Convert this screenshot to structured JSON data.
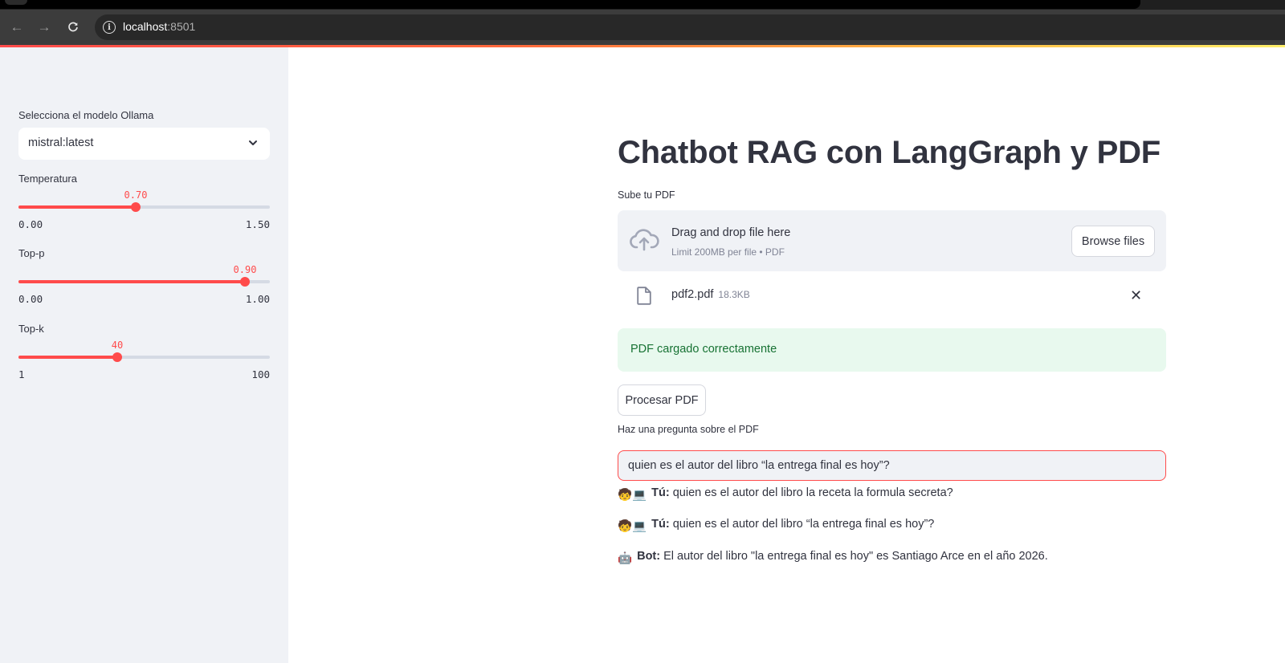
{
  "browser": {
    "url_host": "localhost",
    "url_port": ":8501"
  },
  "sidebar": {
    "model_label": "Selecciona el modelo Ollama",
    "model_value": "mistral:latest",
    "temperature": {
      "label": "Temperatura",
      "value": "0.70",
      "min": "0.00",
      "max": "1.50",
      "fraction": 0.4667
    },
    "top_p": {
      "label": "Top-p",
      "value": "0.90",
      "min": "0.00",
      "max": "1.00",
      "fraction": 0.9
    },
    "top_k": {
      "label": "Top-k",
      "value": "40",
      "min": "1",
      "max": "100",
      "fraction": 0.394
    }
  },
  "main": {
    "title": "Chatbot RAG con LangGraph y PDF",
    "upload_label": "Sube tu PDF",
    "dropzone_title": "Drag and drop file here",
    "dropzone_limit": "Limit 200MB per file • PDF",
    "browse_label": "Browse files",
    "file_name": "pdf2.pdf",
    "file_size": "18.3KB",
    "success_message": "PDF cargado correctamente",
    "process_label": "Procesar PDF",
    "question_label": "Haz una pregunta sobre el PDF",
    "question_value": "quien es el autor del libro “la entrega final es hoy”?"
  },
  "chat": [
    {
      "emoji": "🧒💻",
      "speaker": "Tú:",
      "text": " quien es el autor del libro la receta la formula secreta?"
    },
    {
      "emoji": "🧒💻",
      "speaker": "Tú:",
      "text": " quien es el autor del libro “la entrega final es hoy”?"
    },
    {
      "emoji": "🤖",
      "speaker": "Bot:",
      "text": " El autor del libro \"la entrega final es hoy\" es Santiago Arce en el año 2026."
    }
  ],
  "colors": {
    "accent": "#ff4b4b",
    "sidebar_bg": "#f0f2f6",
    "success_bg": "#e8f9ee",
    "success_text": "#177233"
  }
}
